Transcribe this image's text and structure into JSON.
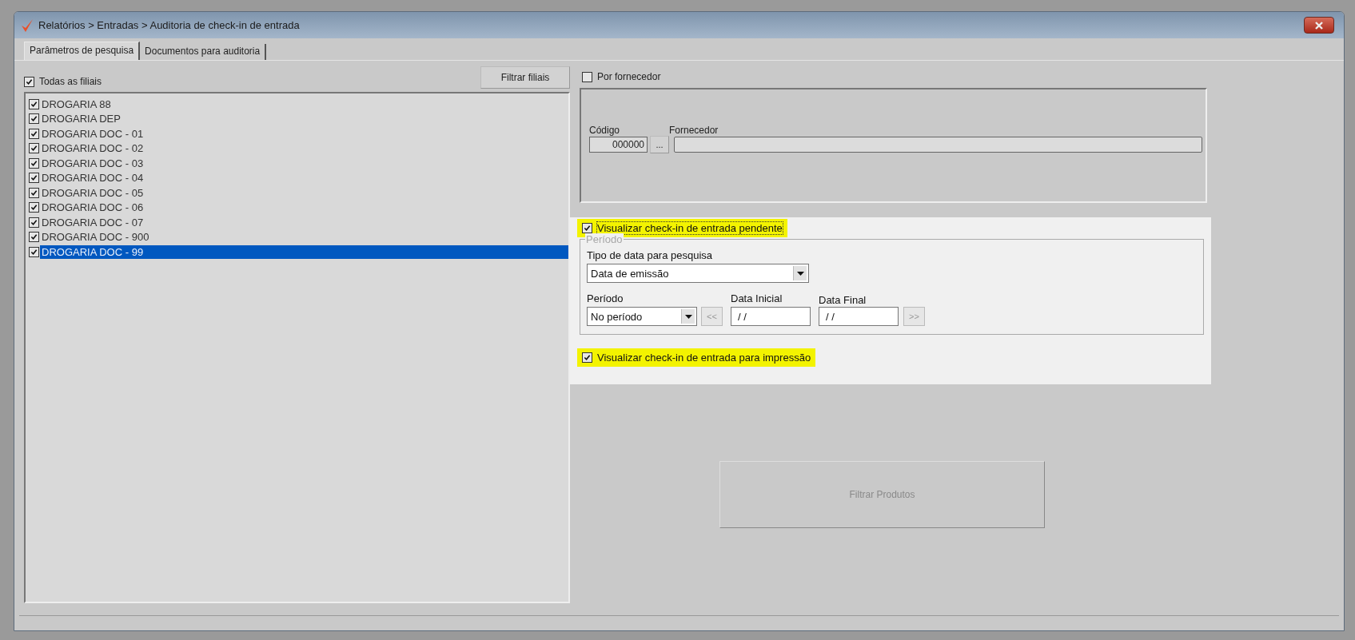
{
  "window": {
    "title": "Relatórios > Entradas > Auditoria de check-in de entrada"
  },
  "tabs": [
    {
      "label": "Parâmetros de pesquisa",
      "selected": true
    },
    {
      "label": "Documentos para auditoria",
      "selected": false
    }
  ],
  "branches": {
    "all": {
      "label": "Todas as filiais",
      "checked": true
    },
    "filter_button": "Filtrar filiais",
    "items": [
      {
        "label": "DROGARIA 88",
        "checked": true,
        "selected": false
      },
      {
        "label": "DROGARIA DEP",
        "checked": true,
        "selected": false
      },
      {
        "label": "DROGARIA DOC - 01",
        "checked": true,
        "selected": false
      },
      {
        "label": "DROGARIA DOC - 02",
        "checked": true,
        "selected": false
      },
      {
        "label": "DROGARIA DOC - 03",
        "checked": true,
        "selected": false
      },
      {
        "label": "DROGARIA DOC - 04",
        "checked": true,
        "selected": false
      },
      {
        "label": "DROGARIA DOC - 05",
        "checked": true,
        "selected": false
      },
      {
        "label": "DROGARIA DOC - 06",
        "checked": true,
        "selected": false
      },
      {
        "label": "DROGARIA DOC - 07",
        "checked": true,
        "selected": false
      },
      {
        "label": "DROGARIA DOC - 900",
        "checked": true,
        "selected": false
      },
      {
        "label": "DROGARIA DOC - 99",
        "checked": true,
        "selected": true
      }
    ]
  },
  "supplier": {
    "label": "Por fornecedor",
    "checked": false,
    "code_label": "Código",
    "code_value": "000000",
    "browse_button": "...",
    "name_label": "Fornecedor"
  },
  "pending": {
    "label": "Visualizar check-in de entrada pendente",
    "checked": true,
    "highlighted": true
  },
  "period_group": {
    "title": "Período",
    "date_type_label": "Tipo de data para pesquisa",
    "date_type": "Data de emissão",
    "period_label": "Período",
    "period": "No período",
    "prev_button": "<<",
    "start_label": "Data Inicial",
    "start": "/ /",
    "end_label": "Data Final",
    "end": "/ /",
    "next_button": ">>"
  },
  "print": {
    "label": "Visualizar check-in de entrada para impressão",
    "checked": true,
    "highlighted": true
  },
  "filter_products_button": {
    "label": "Filtrar Produtos",
    "disabled": true
  }
}
